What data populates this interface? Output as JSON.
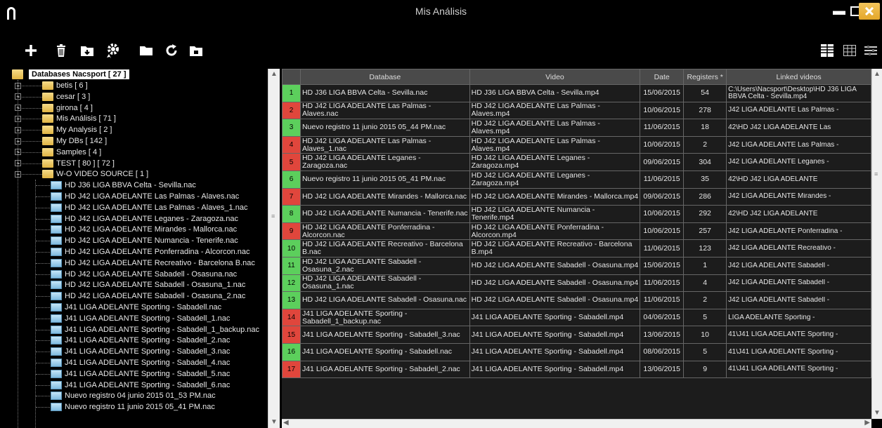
{
  "window": {
    "title": "Mis Análisis"
  },
  "toolbar": {
    "buttons": [
      {
        "name": "add-icon",
        "glyph": "+"
      },
      {
        "name": "delete-icon",
        "glyph": "🗑"
      },
      {
        "name": "import-folder-icon",
        "glyph": "▣"
      },
      {
        "name": "settings-gear-icon",
        "glyph": "⚙"
      },
      {
        "name": "folder-icon",
        "glyph": "■"
      },
      {
        "name": "refresh-icon",
        "glyph": "↻"
      },
      {
        "name": "export-icon",
        "glyph": "▣"
      }
    ],
    "view_buttons": [
      {
        "name": "list-view-icon",
        "glyph": "☰"
      },
      {
        "name": "grid-view-icon",
        "glyph": "▦"
      },
      {
        "name": "filter-options-icon",
        "glyph": "☷"
      }
    ]
  },
  "tree": {
    "root_label": "Databases Nacsport [ 27 ]",
    "folders": [
      "betis [ 6 ]",
      "cesar [ 3 ]",
      "girona [ 4 ]",
      "Mis Análisis [ 71 ]",
      "My Analysis [ 2 ]",
      "My DBs [ 142 ]",
      "Samples [ 4 ]",
      "TEST [ 80 ] [ 72 ]",
      "W-O VIDEO SOURCE [ 1 ]"
    ],
    "files": [
      "HD J36 LIGA BBVA Celta - Sevilla.nac",
      "HD J42 LIGA ADELANTE Las Palmas - Alaves.nac",
      "HD J42 LIGA ADELANTE Las Palmas - Alaves_1.nac",
      "HD J42 LIGA ADELANTE Leganes - Zaragoza.nac",
      "HD J42 LIGA ADELANTE Mirandes - Mallorca.nac",
      "HD J42 LIGA ADELANTE Numancia - Tenerife.nac",
      "HD J42 LIGA ADELANTE Ponferradina - Alcorcon.nac",
      "HD J42 LIGA ADELANTE Recreativo - Barcelona B.nac",
      "HD J42 LIGA ADELANTE Sabadell - Osasuna.nac",
      "HD J42 LIGA ADELANTE Sabadell - Osasuna_1.nac",
      "HD J42 LIGA ADELANTE Sabadell - Osasuna_2.nac",
      "J41 LIGA ADELANTE Sporting - Sabadell.nac",
      "J41 LIGA ADELANTE Sporting - Sabadell_1.nac",
      "J41 LIGA ADELANTE Sporting - Sabadell_1_backup.nac",
      "J41 LIGA ADELANTE Sporting - Sabadell_2.nac",
      "J41 LIGA ADELANTE Sporting - Sabadell_3.nac",
      "J41 LIGA ADELANTE Sporting - Sabadell_4.nac",
      "J41 LIGA ADELANTE Sporting - Sabadell_5.nac",
      "J41 LIGA ADELANTE Sporting - Sabadell_6.nac",
      "Nuevo registro 04 junio 2015 01_53 PM.nac",
      "Nuevo registro 11 junio 2015 05_41 PM.nac"
    ]
  },
  "table": {
    "columns": [
      "",
      "Database",
      "Video",
      "Date",
      "Registers *",
      "Linked videos"
    ],
    "status_colors": {
      "ok": "#5ccf5c",
      "missing": "#e0463c"
    },
    "rows": [
      {
        "n": "1",
        "status": "ok",
        "database": "HD J36 LIGA BBVA Celta - Sevilla.nac",
        "video": "HD J36 LIGA BBVA Celta - Sevilla.mp4",
        "date": "15/06/2015",
        "registers": "54",
        "linked": "C:\\Users\\Nacsport\\Desktop\\HD J36 LIGA BBVA Celta - Sevilla.mp4"
      },
      {
        "n": "2",
        "status": "missing",
        "database": "HD J42 LIGA ADELANTE Las Palmas - Alaves.nac",
        "video": "HD J42 LIGA ADELANTE Las Palmas - Alaves.mp4",
        "date": "10/06/2015",
        "registers": "278",
        "linked": "J42 LIGA ADELANTE Las Palmas -"
      },
      {
        "n": "3",
        "status": "ok",
        "database": "Nuevo registro 11 junio 2015 05_44 PM.nac",
        "video": "HD J42 LIGA ADELANTE Las Palmas - Alaves.mp4",
        "date": "11/06/2015",
        "registers": "18",
        "linked": "42\\HD J42 LIGA ADELANTE Las"
      },
      {
        "n": "4",
        "status": "missing",
        "database": "HD J42 LIGA ADELANTE Las Palmas - Alaves_1.nac",
        "video": "HD J42 LIGA ADELANTE Las Palmas - Alaves.mp4",
        "date": "10/06/2015",
        "registers": "2",
        "linked": "J42 LIGA ADELANTE Las Palmas -"
      },
      {
        "n": "5",
        "status": "missing",
        "database": "HD J42 LIGA ADELANTE Leganes - Zaragoza.nac",
        "video": "HD J42 LIGA ADELANTE Leganes - Zaragoza.mp4",
        "date": "09/06/2015",
        "registers": "304",
        "linked": "J42 LIGA ADELANTE Leganes -"
      },
      {
        "n": "6",
        "status": "ok",
        "database": "Nuevo registro 11 junio 2015 05_41 PM.nac",
        "video": "HD J42 LIGA ADELANTE Leganes - Zaragoza.mp4",
        "date": "11/06/2015",
        "registers": "35",
        "linked": "42\\HD J42 LIGA ADELANTE"
      },
      {
        "n": "7",
        "status": "missing",
        "database": "HD J42 LIGA ADELANTE Mirandes - Mallorca.nac",
        "video": "HD J42 LIGA ADELANTE Mirandes - Mallorca.mp4",
        "date": "09/06/2015",
        "registers": "286",
        "linked": "J42 LIGA ADELANTE Mirandes -"
      },
      {
        "n": "8",
        "status": "ok",
        "database": "HD J42 LIGA ADELANTE Numancia - Tenerife.nac",
        "video": "HD J42 LIGA ADELANTE Numancia - Tenerife.mp4",
        "date": "10/06/2015",
        "registers": "292",
        "linked": "42\\HD J42 LIGA ADELANTE"
      },
      {
        "n": "9",
        "status": "missing",
        "database": "HD J42 LIGA ADELANTE Ponferradina - Alcorcon.nac",
        "video": "HD J42 LIGA ADELANTE Ponferradina - Alcorcon.mp4",
        "date": "10/06/2015",
        "registers": "257",
        "linked": "J42 LIGA ADELANTE Ponferradina -"
      },
      {
        "n": "10",
        "status": "ok",
        "database": "HD J42 LIGA ADELANTE Recreativo - Barcelona B.nac",
        "video": "HD J42 LIGA ADELANTE Recreativo - Barcelona B.mp4",
        "date": "11/06/2015",
        "registers": "123",
        "linked": "J42 LIGA ADELANTE Recreativo -"
      },
      {
        "n": "11",
        "status": "ok",
        "database": "HD J42 LIGA ADELANTE Sabadell - Osasuna_2.nac",
        "video": "HD J42 LIGA ADELANTE Sabadell - Osasuna.mp4",
        "date": "15/06/2015",
        "registers": "1",
        "linked": "J42 LIGA ADELANTE Sabadell -"
      },
      {
        "n": "12",
        "status": "ok",
        "database": "HD J42 LIGA ADELANTE Sabadell - Osasuna_1.nac",
        "video": "HD J42 LIGA ADELANTE Sabadell - Osasuna.mp4",
        "date": "11/06/2015",
        "registers": "4",
        "linked": "J42 LIGA ADELANTE Sabadell -"
      },
      {
        "n": "13",
        "status": "ok",
        "database": "HD J42 LIGA ADELANTE Sabadell - Osasuna.nac",
        "video": "HD J42 LIGA ADELANTE Sabadell - Osasuna.mp4",
        "date": "11/06/2015",
        "registers": "2",
        "linked": "J42 LIGA ADELANTE Sabadell -"
      },
      {
        "n": "14",
        "status": "missing",
        "database": "J41 LIGA ADELANTE Sporting - Sabadell_1_backup.nac",
        "video": "J41 LIGA ADELANTE Sporting - Sabadell.mp4",
        "date": "04/06/2015",
        "registers": "5",
        "linked": "LIGA ADELANTE Sporting -"
      },
      {
        "n": "15",
        "status": "missing",
        "database": "J41 LIGA ADELANTE Sporting - Sabadell_3.nac",
        "video": "J41 LIGA ADELANTE Sporting - Sabadell.mp4",
        "date": "13/06/2015",
        "registers": "10",
        "linked": "41\\J41 LIGA ADELANTE Sporting -"
      },
      {
        "n": "16",
        "status": "ok",
        "database": "J41 LIGA ADELANTE Sporting - Sabadell.nac",
        "video": "J41 LIGA ADELANTE Sporting - Sabadell.mp4",
        "date": "08/06/2015",
        "registers": "5",
        "linked": "41\\J41 LIGA ADELANTE Sporting -"
      },
      {
        "n": "17",
        "status": "missing",
        "database": "J41 LIGA ADELANTE Sporting - Sabadell_2.nac",
        "video": "J41 LIGA ADELANTE Sporting - Sabadell.mp4",
        "date": "13/06/2015",
        "registers": "9",
        "linked": "41\\J41 LIGA ADELANTE Sporting -"
      }
    ]
  }
}
